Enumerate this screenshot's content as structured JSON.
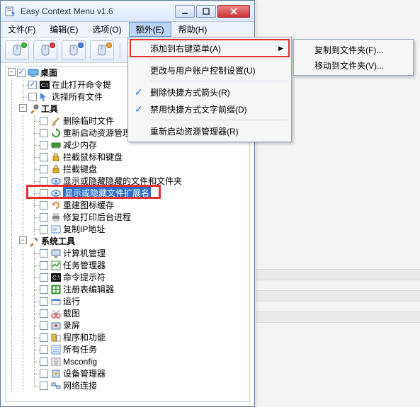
{
  "title": "Easy Context Menu v1.6",
  "menubar": [
    "文件(F)",
    "编辑(E)",
    "选项(O)",
    "额外(E)",
    "帮助(H)"
  ],
  "menubar_hover_index": 3,
  "dropdown": {
    "items": [
      {
        "label": "添加到右键菜单(A)",
        "highlight": true,
        "submenu": true
      },
      {
        "sep": true
      },
      {
        "label": "更改与用户账户控制设置(U)"
      },
      {
        "sep": true
      },
      {
        "label": "删除快捷方式箭头(R)",
        "checked": true
      },
      {
        "label": "禁用快捷方式文字前缀(D)",
        "checked": true
      },
      {
        "sep": true
      },
      {
        "label": "重新启动资源管理器(R)"
      }
    ]
  },
  "submenu": [
    "复制到文件夹(F)...",
    "移动到文件夹(V)..."
  ],
  "tree": [
    {
      "d": 0,
      "exp": "-",
      "chk": true,
      "icon": "desktop",
      "label": "桌面",
      "bold": true
    },
    {
      "d": 1,
      "chk": true,
      "icon": "cmd",
      "label": "在此打开命令提",
      "clip": true
    },
    {
      "d": 1,
      "chk": false,
      "icon": "select",
      "label": "选择所有文件"
    },
    {
      "d": 1,
      "exp": "-",
      "icon": "tools",
      "label": "工具",
      "bold": true
    },
    {
      "d": 2,
      "chk": false,
      "icon": "broom",
      "label": "删除临时文件"
    },
    {
      "d": 2,
      "chk": false,
      "icon": "restart",
      "label": "重新启动资源管理器"
    },
    {
      "d": 2,
      "chk": false,
      "icon": "ram",
      "label": "减少内存"
    },
    {
      "d": 2,
      "chk": false,
      "icon": "lock",
      "label": "拦截鼠标和键盘"
    },
    {
      "d": 2,
      "chk": false,
      "icon": "lock",
      "label": "拦截键盘"
    },
    {
      "d": 2,
      "chk": false,
      "icon": "eye",
      "label": "显示或隐藏隐藏的文件和文件夹"
    },
    {
      "d": 2,
      "chk": false,
      "icon": "eye",
      "label": "显示或隐藏文件扩展名",
      "selected": true
    },
    {
      "d": 2,
      "chk": false,
      "icon": "refresh",
      "label": "重建图标缓存"
    },
    {
      "d": 2,
      "chk": false,
      "icon": "printer",
      "label": "修复打印后台进程"
    },
    {
      "d": 2,
      "chk": false,
      "icon": "ip",
      "label": "复制IP地址"
    },
    {
      "d": 1,
      "exp": "-",
      "icon": "systools",
      "label": "系统工具",
      "bold": true
    },
    {
      "d": 2,
      "chk": false,
      "icon": "pc",
      "label": "计算机管理"
    },
    {
      "d": 2,
      "chk": false,
      "icon": "task",
      "label": "任务管理器"
    },
    {
      "d": 2,
      "chk": false,
      "icon": "cmd",
      "label": "命令提示符"
    },
    {
      "d": 2,
      "chk": false,
      "icon": "reg",
      "label": "注册表编辑器"
    },
    {
      "d": 2,
      "chk": false,
      "icon": "run",
      "label": "运行"
    },
    {
      "d": 2,
      "chk": false,
      "icon": "snip",
      "label": "截图"
    },
    {
      "d": 2,
      "chk": false,
      "icon": "record",
      "label": "录屏"
    },
    {
      "d": 2,
      "chk": false,
      "icon": "prog",
      "label": "程序和功能"
    },
    {
      "d": 2,
      "chk": false,
      "icon": "tasks",
      "label": "所有任务"
    },
    {
      "d": 2,
      "chk": false,
      "icon": "msconfig",
      "label": "Msconfig"
    },
    {
      "d": 2,
      "chk": false,
      "icon": "devmgr",
      "label": "设备管理器"
    },
    {
      "d": 2,
      "chk": false,
      "icon": "net",
      "label": "网络连接"
    }
  ]
}
